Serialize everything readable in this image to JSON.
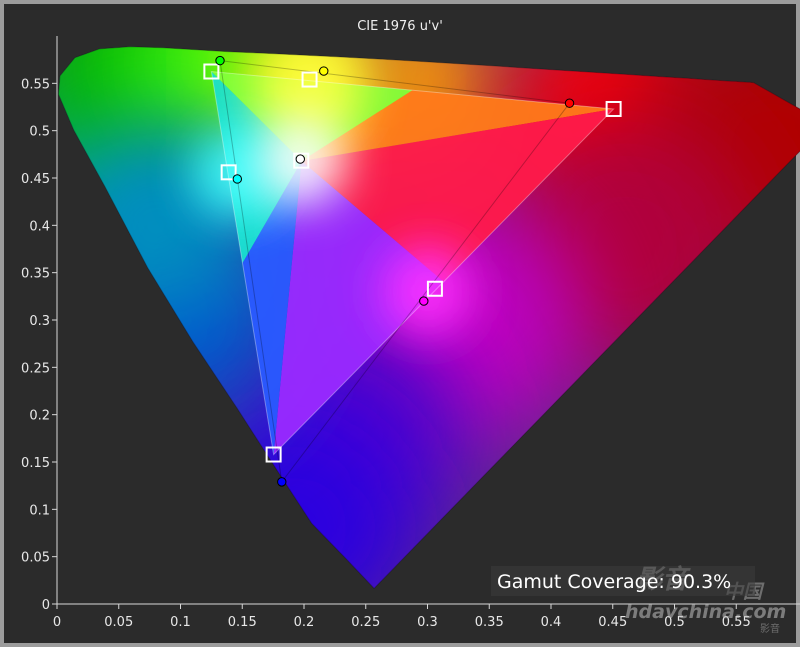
{
  "chart_data": {
    "type": "scatter",
    "title": "CIE 1976 u'v'",
    "xlabel": "",
    "ylabel": "",
    "xlim": [
      0,
      0.6
    ],
    "ylim": [
      0,
      0.6
    ],
    "x_ticks": [
      0,
      0.05,
      0.1,
      0.15,
      0.2,
      0.25,
      0.3,
      0.35,
      0.4,
      0.45,
      0.5,
      0.55
    ],
    "x_tick_labels": [
      "0",
      "0.05",
      "0.1",
      "0.15",
      "0.2",
      "0.25",
      "0.3",
      "0.35",
      "0.4",
      "0.45",
      "0.5",
      "0.55"
    ],
    "y_ticks": [
      0,
      0.05,
      0.1,
      0.15,
      0.2,
      0.25,
      0.3,
      0.35,
      0.4,
      0.45,
      0.5,
      0.55
    ],
    "y_tick_labels": [
      "0",
      "0.05",
      "0.1",
      "0.15",
      "0.2",
      "0.25",
      "0.3",
      "0.35",
      "0.4",
      "0.45",
      "0.5",
      "0.55"
    ],
    "grid": false,
    "spectral_locus": [
      [
        0.2568,
        0.0165
      ],
      [
        0.2353,
        0.0461
      ],
      [
        0.2063,
        0.085
      ],
      [
        0.1787,
        0.1402
      ],
      [
        0.146,
        0.2065
      ],
      [
        0.1103,
        0.2766
      ],
      [
        0.0735,
        0.355
      ],
      [
        0.0389,
        0.4409
      ],
      [
        0.0137,
        0.5004
      ],
      [
        0.0012,
        0.5385
      ],
      [
        0.0024,
        0.5579
      ],
      [
        0.0145,
        0.5771
      ],
      [
        0.0344,
        0.5864
      ],
      [
        0.0593,
        0.5887
      ],
      [
        0.0854,
        0.5876
      ],
      [
        0.1123,
        0.5855
      ],
      [
        0.1388,
        0.5834
      ],
      [
        0.1673,
        0.5817
      ],
      [
        0.1963,
        0.5799
      ],
      [
        0.2256,
        0.578
      ],
      [
        0.2562,
        0.576
      ],
      [
        0.2882,
        0.5736
      ],
      [
        0.3213,
        0.5709
      ],
      [
        0.355,
        0.5683
      ],
      [
        0.3887,
        0.5655
      ],
      [
        0.4207,
        0.5628
      ],
      [
        0.4495,
        0.5604
      ],
      [
        0.4743,
        0.5583
      ],
      [
        0.495,
        0.5566
      ],
      [
        0.5106,
        0.5553
      ],
      [
        0.523,
        0.5542
      ],
      [
        0.5325,
        0.5534
      ],
      [
        0.5398,
        0.5528
      ],
      [
        0.5456,
        0.5523
      ],
      [
        0.5499,
        0.552
      ],
      [
        0.5531,
        0.5517
      ],
      [
        0.5558,
        0.5515
      ],
      [
        0.5579,
        0.5513
      ],
      [
        0.5595,
        0.5512
      ],
      [
        0.5607,
        0.5511
      ],
      [
        0.5625,
        0.5509
      ],
      [
        0.564,
        0.5508
      ],
      [
        0.623,
        0.507
      ]
    ],
    "target_gamut": [
      [
        0.4507,
        0.5229
      ],
      [
        0.125,
        0.5625
      ],
      [
        0.1754,
        0.1579
      ]
    ],
    "measured_gamut": [
      [
        0.415,
        0.529
      ],
      [
        0.132,
        0.574
      ],
      [
        0.182,
        0.129
      ]
    ],
    "series": [
      {
        "name": "",
        "marker": "square",
        "points": [
          {
            "x": 0.4507,
            "y": 0.5229,
            "color": "#ff0000"
          },
          {
            "x": 0.125,
            "y": 0.5625,
            "color": "#00ff00"
          },
          {
            "x": 0.1754,
            "y": 0.1579,
            "color": "#0000ff"
          },
          {
            "x": 0.2045,
            "y": 0.554,
            "color": "#ffff00"
          },
          {
            "x": 0.139,
            "y": 0.456,
            "color": "#00ffff"
          },
          {
            "x": 0.306,
            "y": 0.333,
            "color": "#ff00ff"
          },
          {
            "x": 0.1978,
            "y": 0.4683,
            "color": "#ffffff"
          }
        ]
      },
      {
        "name": "",
        "marker": "circle",
        "points": [
          {
            "x": 0.415,
            "y": 0.529,
            "color": "#ff0000"
          },
          {
            "x": 0.132,
            "y": 0.574,
            "color": "#00ff00"
          },
          {
            "x": 0.182,
            "y": 0.129,
            "color": "#0000ff"
          },
          {
            "x": 0.216,
            "y": 0.563,
            "color": "#ffff00"
          },
          {
            "x": 0.146,
            "y": 0.449,
            "color": "#00ffff"
          },
          {
            "x": 0.297,
            "y": 0.32,
            "color": "#ff00ff"
          },
          {
            "x": 0.197,
            "y": 0.47,
            "color": "#ffffff"
          }
        ]
      }
    ],
    "annotation": "Gamut Coverage:  90.3%"
  },
  "watermark": {
    "logo_text": "影音",
    "site_text": "hdavchina.com",
    "country_text": "中国",
    "corner_text": "影音"
  },
  "colors": {
    "background": "#262626",
    "frame": "#9c9c9c",
    "axis": "#d8d8d8",
    "marker_outline": "#000000",
    "target_outline": "#ffffff"
  }
}
